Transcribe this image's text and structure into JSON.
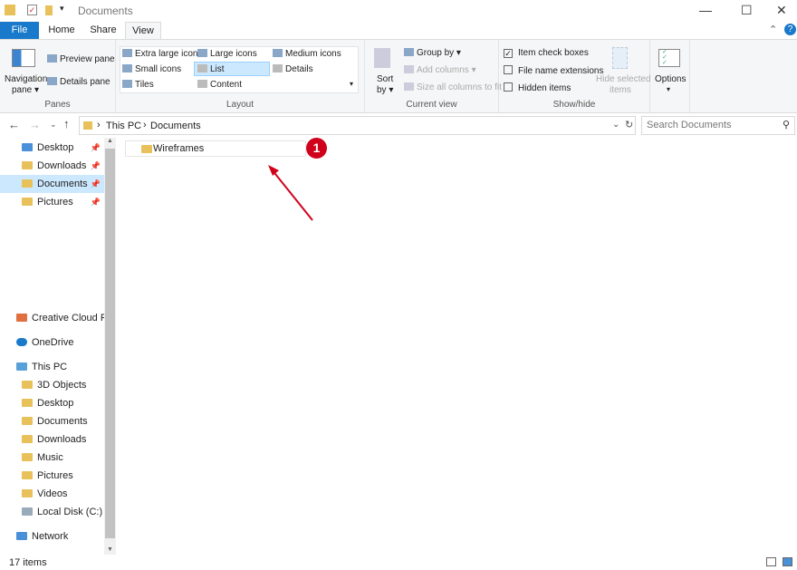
{
  "title_bar": {
    "title": "Documents",
    "minimize": "—",
    "maximize": "☐",
    "close": "✕"
  },
  "tabs": [
    {
      "label": "File"
    },
    {
      "label": "Home"
    },
    {
      "label": "Share"
    },
    {
      "label": "View"
    }
  ],
  "help": "?",
  "ribbon": {
    "panes": {
      "label": "Panes",
      "navigation_pane": "Navigation",
      "navigation_pane2": "pane ▾",
      "preview_pane": "Preview pane",
      "details_pane": "Details pane"
    },
    "layout": {
      "label": "Layout",
      "items": [
        "Extra large icons",
        "Large icons",
        "Medium icons",
        "Small icons",
        "List",
        "Details",
        "Tiles",
        "Content"
      ],
      "selected": "List"
    },
    "current_view": {
      "label": "Current view",
      "sort_by": "Sort",
      "sort_by2": "by ▾",
      "group_by": "Group by ▾",
      "add_columns": "Add columns ▾",
      "size_columns": "Size all columns to fit"
    },
    "show_hide": {
      "label": "Show/hide",
      "item_check_boxes": "Item check boxes",
      "item_check_boxes_checked": true,
      "file_name_extensions": "File name extensions",
      "hidden_items": "Hidden items",
      "hide_selected": "Hide selected",
      "hide_selected2": "items"
    },
    "options": {
      "label": "Options",
      "arrow": "▾"
    }
  },
  "address": {
    "crumbs": [
      "This PC",
      "Documents"
    ],
    "search_placeholder": "Search Documents"
  },
  "nav": {
    "quick": [
      {
        "label": "Desktop",
        "pinned": true
      },
      {
        "label": "Downloads",
        "pinned": true
      },
      {
        "label": "Documents",
        "pinned": true,
        "selected": true
      },
      {
        "label": "Pictures",
        "pinned": true
      }
    ],
    "creative_cloud": "Creative Cloud Files",
    "onedrive": "OneDrive",
    "this_pc": "This PC",
    "pc_items": [
      "3D Objects",
      "Desktop",
      "Documents",
      "Downloads",
      "Music",
      "Pictures",
      "Videos",
      "Local Disk (C:)"
    ],
    "network": "Network"
  },
  "files": [
    {
      "name": "Wireframes"
    }
  ],
  "annotation": {
    "badge": "1",
    "color": "#d0021b"
  },
  "status": {
    "count": "17 items"
  }
}
